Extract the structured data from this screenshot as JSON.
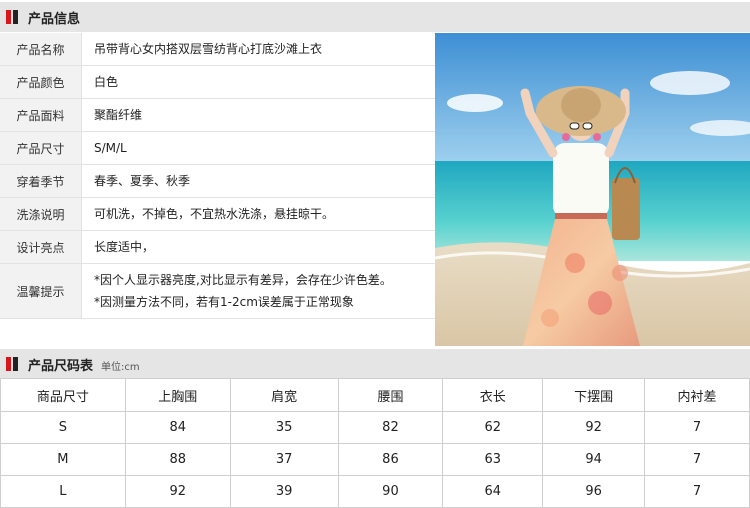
{
  "product_info": {
    "title": "产品信息",
    "rows": [
      {
        "label": "产品名称",
        "values": [
          "吊带背心女内搭双层雪纺背心打底沙滩上衣"
        ]
      },
      {
        "label": "产品颜色",
        "values": [
          "白色"
        ]
      },
      {
        "label": "产品面料",
        "values": [
          "聚酯纤维"
        ]
      },
      {
        "label": "产品尺寸",
        "values": [
          "S/M/L"
        ]
      },
      {
        "label": "穿着季节",
        "values": [
          "春季、夏季、秋季"
        ]
      },
      {
        "label": "洗涤说明",
        "values": [
          "可机洗，不掉色，不宜热水洗涤，悬挂晾干。"
        ]
      },
      {
        "label": "设计亮点",
        "values": [
          "长度适中，"
        ]
      },
      {
        "label": "温馨提示",
        "values": [
          "*因个人显示器亮度,对比显示有差异，会存在少许色差。",
          "*因测量方法不同，若有1-2cm误差属于正常现象"
        ]
      }
    ]
  },
  "size_chart": {
    "title": "产品尺码表",
    "unit": "单位:cm",
    "headers": [
      "商品尺寸",
      "上胸围",
      "肩宽",
      "腰围",
      "衣长",
      "下摆围",
      "内衬差"
    ],
    "rows": [
      [
        "S",
        "84",
        "35",
        "82",
        "62",
        "92",
        "7"
      ],
      [
        "M",
        "88",
        "37",
        "86",
        "63",
        "94",
        "7"
      ],
      [
        "L",
        "92",
        "39",
        "90",
        "64",
        "96",
        "7"
      ]
    ]
  },
  "colors": {
    "accent_red": "#d7171c",
    "header_bg": "#e5e5e5",
    "label_bg": "#f2f2f2"
  }
}
